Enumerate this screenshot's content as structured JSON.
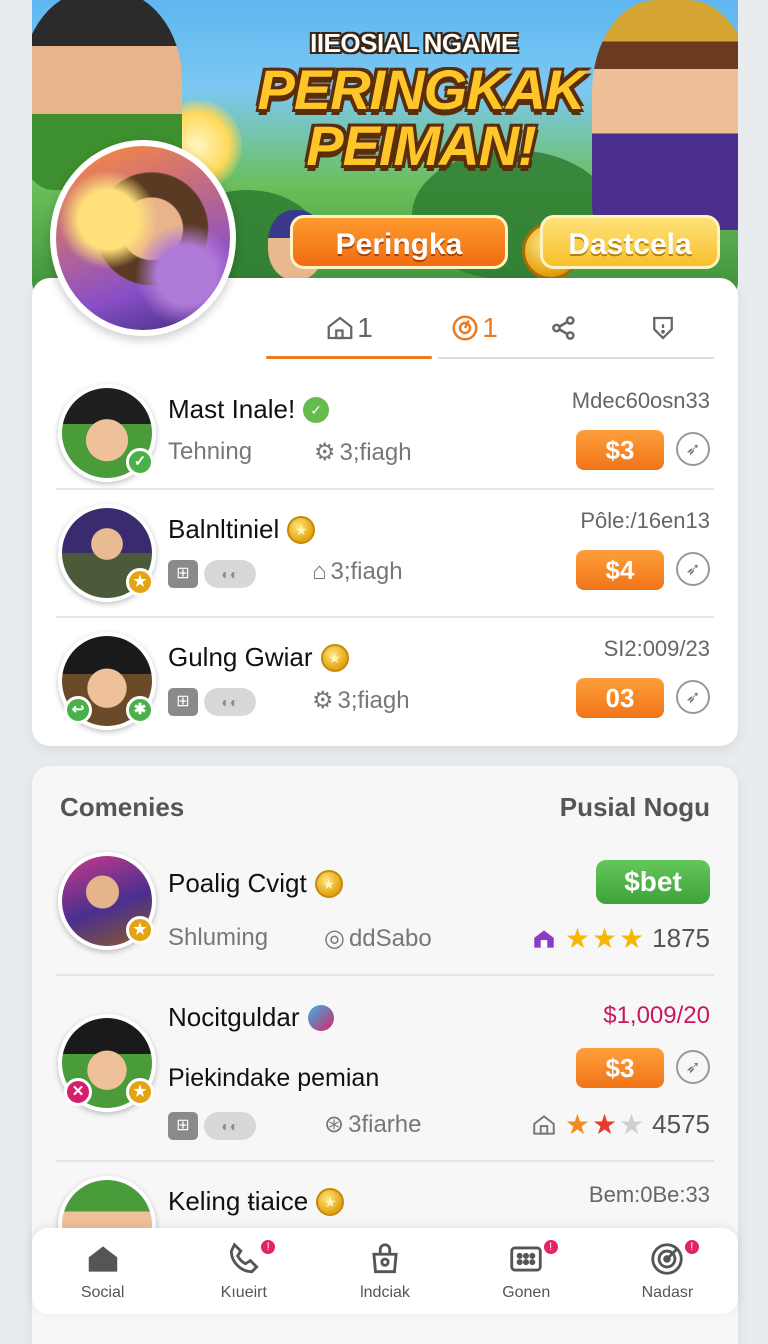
{
  "hero": {
    "subtitle": "IIEOSIAL NGAME",
    "title_line1": "PERINGKAK",
    "title_line2": "PEIMAN!",
    "primary_button": "Peringka",
    "secondary_button": "Dastcela",
    "colors": {
      "accent": "#ee7a1d",
      "title": "#ffc62a"
    }
  },
  "tabs": [
    {
      "icon": "home-icon",
      "label": "1"
    },
    {
      "icon": "target-icon",
      "label": "1"
    },
    {
      "icon": "share-icon",
      "label": ""
    },
    {
      "icon": "shield-icon",
      "label": ""
    }
  ],
  "leaderboard": [
    {
      "name": "Mast Inale!",
      "sub": "Tehning",
      "meta": "3;fiagh",
      "time": "Mdec60osn33",
      "price": "$3"
    },
    {
      "name": "Balnltiniel",
      "sub": "",
      "meta": "3;fiagh",
      "time": "Pôle:/16en13",
      "price": "$4"
    },
    {
      "name": "Gulng Gwiar",
      "sub": "",
      "meta": "3;fiagh",
      "time": "SI2:009/23",
      "price": "03"
    }
  ],
  "communities": {
    "heading": "Comenies",
    "heading_right": "Pusial Nogu",
    "items": [
      {
        "name": "Poalig Cvigt",
        "sub": "Shluming",
        "meta": "ddSabo",
        "button": "$bet",
        "stars_value": 3,
        "count": "1875"
      },
      {
        "name": "Nocitguldar",
        "sub": "Piekindake pemian",
        "meta": "3fiarhe",
        "price_text": "$1,009/20",
        "price": "$3",
        "stars_value": 2,
        "count": "4575"
      },
      {
        "name": "Keling ŧiaice",
        "time": "Bem:0Be:33"
      }
    ]
  },
  "nav": [
    {
      "label": "Social",
      "icon": "home-icon",
      "badge": false
    },
    {
      "label": "Kıueirt",
      "icon": "phone-icon",
      "badge": true
    },
    {
      "label": "lndciak",
      "icon": "bag-icon",
      "badge": false
    },
    {
      "label": "Gonen",
      "icon": "grid-icon",
      "badge": true
    },
    {
      "label": "Nadasr",
      "icon": "radar-icon",
      "badge": true
    }
  ]
}
